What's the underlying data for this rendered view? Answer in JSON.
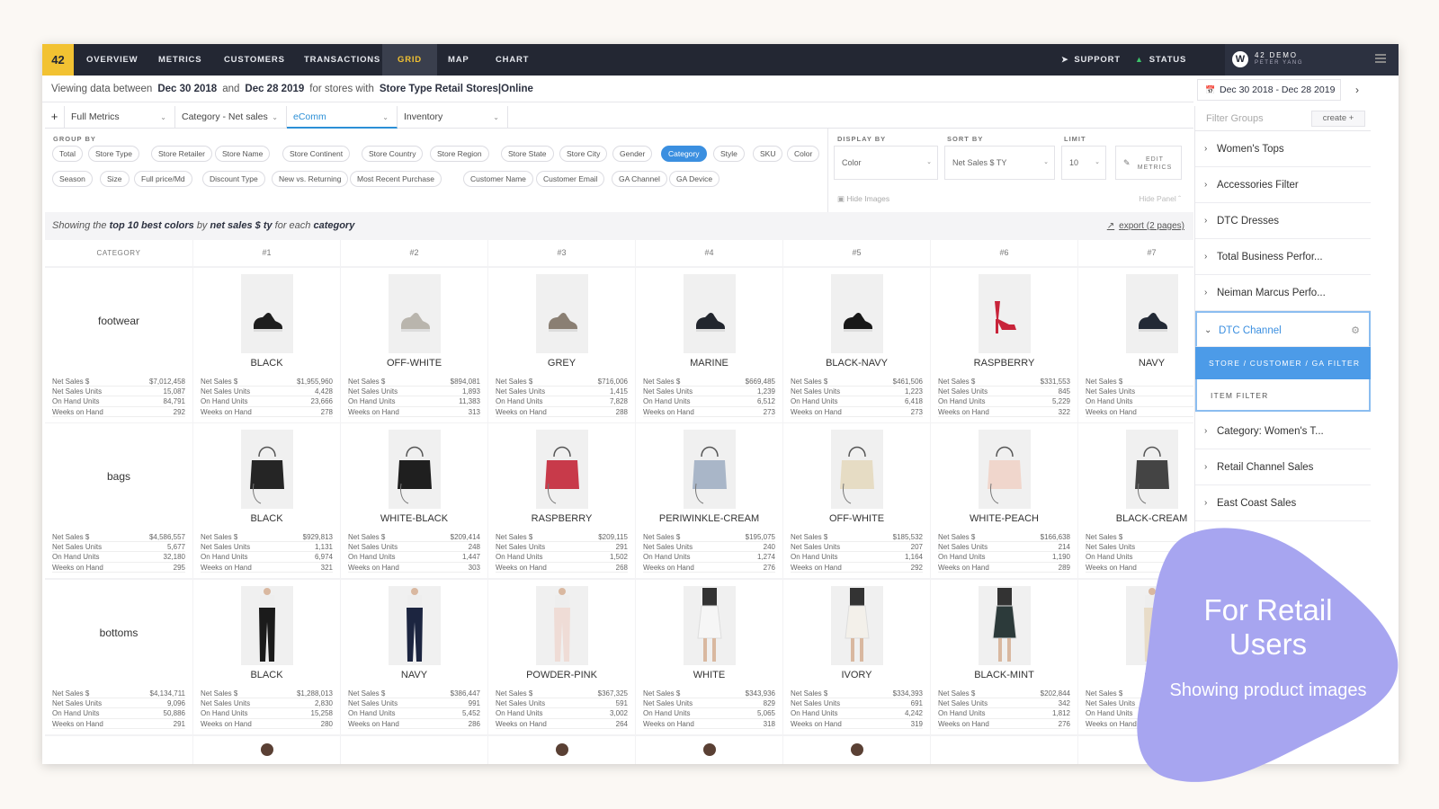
{
  "nav": {
    "logo": "42",
    "items": [
      "OVERVIEW",
      "METRICS",
      "CUSTOMERS",
      "TRANSACTIONS",
      "GRID",
      "MAP",
      "CHART"
    ],
    "active": "GRID",
    "support": "SUPPORT",
    "status": "STATUS",
    "account_name": "42 DEMO",
    "account_user": "PETER YANG"
  },
  "infobar": {
    "prefix": "Viewing data between",
    "start": "Dec 30 2018",
    "and": "and",
    "end": "Dec 28 2019",
    "stores_text": "for stores with",
    "store_filter": "Store Type Retail Stores|Online",
    "date_range": "Dec 30 2018 - Dec 28 2019"
  },
  "tabs": [
    "Full Metrics",
    "Category - Net sales",
    "eComm",
    "Inventory"
  ],
  "active_tab": "eComm",
  "group_by": {
    "label": "GROUP BY",
    "row1": [
      "Total",
      "Store Type",
      "Store Retailer",
      "Store Name",
      "Store Continent",
      "Store Country",
      "Store Region",
      "Store State",
      "Store City",
      "Gender",
      "Category",
      "Style",
      "SKU",
      "Color"
    ],
    "row2": [
      "Season",
      "Size",
      "Full price/Md",
      "Discount Type",
      "New vs. Returning",
      "Most Recent Purchase",
      "Customer Name",
      "Customer Email",
      "GA Channel",
      "GA Device"
    ],
    "active": "Category"
  },
  "display": {
    "display_by_label": "DISPLAY BY",
    "sort_by_label": "SORT BY",
    "limit_label": "LIMIT",
    "display_by": "Color",
    "sort_by": "Net Sales $ TY",
    "limit": "10",
    "edit_metrics": "EDIT METRICS",
    "hide_images": "Hide Images",
    "hide_panel": "Hide Panel"
  },
  "summary": {
    "p1": "Showing the",
    "b1": "top 10 best colors",
    "p2": "by",
    "b2": "net sales $ ty",
    "p3": "for each",
    "b3": "category",
    "export": "export (2 pages)"
  },
  "grid": {
    "category_header": "CATEGORY",
    "columns": [
      "#1",
      "#2",
      "#3",
      "#4",
      "#5",
      "#6",
      "#7"
    ],
    "metric_labels": [
      "Net Sales $",
      "Net Sales Units",
      "On Hand Units",
      "Weeks on Hand"
    ],
    "rows": [
      {
        "category": "footwear",
        "totals": [
          "$7,012,458",
          "15,087",
          "84,791",
          "292"
        ],
        "items": [
          {
            "name": "BLACK",
            "vals": [
              "$1,955,960",
              "4,428",
              "23,666",
              "278"
            ]
          },
          {
            "name": "OFF-WHITE",
            "vals": [
              "$894,081",
              "1,893",
              "11,383",
              "313"
            ]
          },
          {
            "name": "GREY",
            "vals": [
              "$716,006",
              "1,415",
              "7,828",
              "288"
            ]
          },
          {
            "name": "MARINE",
            "vals": [
              "$669,485",
              "1,239",
              "6,512",
              "273"
            ]
          },
          {
            "name": "BLACK-NAVY",
            "vals": [
              "$461,506",
              "1,223",
              "6,418",
              "273"
            ]
          },
          {
            "name": "RASPBERRY",
            "vals": [
              "$331,553",
              "845",
              "5,229",
              "322"
            ]
          },
          {
            "name": "NAVY",
            "vals": [
              "$",
              "",
              "",
              ""
            ]
          }
        ]
      },
      {
        "category": "bags",
        "totals": [
          "$4,586,557",
          "5,677",
          "32,180",
          "295"
        ],
        "items": [
          {
            "name": "BLACK",
            "vals": [
              "$929,813",
              "1,131",
              "6,974",
              "321"
            ]
          },
          {
            "name": "WHITE-BLACK",
            "vals": [
              "$209,414",
              "248",
              "1,447",
              "303"
            ]
          },
          {
            "name": "RASPBERRY",
            "vals": [
              "$209,115",
              "291",
              "1,502",
              "268"
            ]
          },
          {
            "name": "PERIWINKLE-CREAM",
            "vals": [
              "$195,075",
              "240",
              "1,274",
              "276"
            ]
          },
          {
            "name": "OFF-WHITE",
            "vals": [
              "$185,532",
              "207",
              "1,164",
              "292"
            ]
          },
          {
            "name": "WHITE-PEACH",
            "vals": [
              "$166,638",
              "214",
              "1,190",
              "289"
            ]
          },
          {
            "name": "BLACK-CREAM",
            "vals": [
              "",
              "",
              "",
              ""
            ]
          }
        ]
      },
      {
        "category": "bottoms",
        "totals": [
          "$4,134,711",
          "9,096",
          "50,886",
          "291"
        ],
        "items": [
          {
            "name": "BLACK",
            "vals": [
              "$1,288,013",
              "2,830",
              "15,258",
              "280"
            ]
          },
          {
            "name": "NAVY",
            "vals": [
              "$386,447",
              "991",
              "5,452",
              "286"
            ]
          },
          {
            "name": "POWDER-PINK",
            "vals": [
              "$367,325",
              "591",
              "3,002",
              "264"
            ]
          },
          {
            "name": "WHITE",
            "vals": [
              "$343,936",
              "829",
              "5,065",
              "318"
            ]
          },
          {
            "name": "IVORY",
            "vals": [
              "$334,393",
              "691",
              "4,242",
              "319"
            ]
          },
          {
            "name": "BLACK-MINT",
            "vals": [
              "$202,844",
              "342",
              "1,812",
              "276"
            ]
          },
          {
            "name": "CR",
            "vals": [
              "",
              "",
              "",
              ""
            ]
          }
        ]
      }
    ],
    "product_images": [
      [
        "shoe-black",
        "shoe-offwhite",
        "shoe-grey",
        "shoe-marine",
        "shoe-blacknavy",
        "heel-raspberry",
        "shoe-navy"
      ],
      [
        "bag-black",
        "bag-whiteblack",
        "bag-raspberry",
        "bag-periwinkle",
        "bag-offwhite",
        "bag-peach",
        "bag-blackcream"
      ],
      [
        "pants-black",
        "pants-navy",
        "pants-pink",
        "skirt-white",
        "skirt-ivory",
        "skirt-blackmint",
        "pants-cream"
      ]
    ]
  },
  "sidebar": {
    "filter_placeholder": "Filter Groups",
    "create": "create",
    "items": [
      "Women's Tops",
      "Accessories Filter",
      "DTC Dresses",
      "Total Business Perfor...",
      "Neiman Marcus Perfo...",
      "DTC Channel"
    ],
    "sub_items": [
      "STORE / CUSTOMER / GA FILTER",
      "ITEM FILTER"
    ],
    "items_after": [
      "Category: Women's T...",
      "Retail Channel Sales",
      "East Coast Sales"
    ]
  },
  "promo": {
    "title": "For Retail Users",
    "subtitle": "Showing product images"
  },
  "colors": {
    "nav_bg": "#232733",
    "accent_yellow": "#f2c232",
    "accent_blue": "#3b8fe0",
    "blob": "#a7a5f0"
  }
}
